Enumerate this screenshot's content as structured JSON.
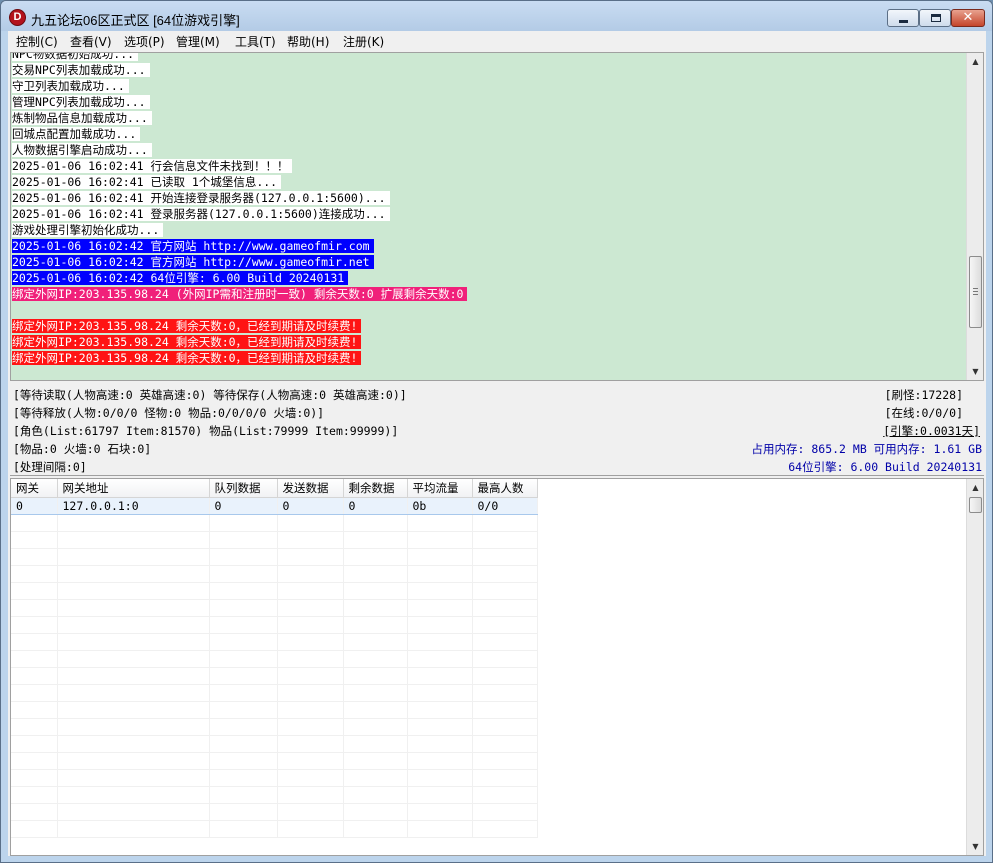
{
  "window": {
    "title": "九五论坛06区正式区 [64位游戏引擎]",
    "icon_letter": "D",
    "minimize": "minimize",
    "maximize": "maximize",
    "close": "✕"
  },
  "menu": [
    "控制(C)",
    "查看(V)",
    "选项(P)",
    "管理(M)",
    "工具(T)",
    "帮助(H)",
    "注册(K)"
  ],
  "log": [
    {
      "text": "NPC物数据初始成功...",
      "style": "white"
    },
    {
      "text": "交易NPC列表加载成功...",
      "style": "white"
    },
    {
      "text": "守卫列表加载成功...",
      "style": "white"
    },
    {
      "text": "管理NPC列表加载成功...",
      "style": "white"
    },
    {
      "text": "炼制物品信息加载成功...",
      "style": "white"
    },
    {
      "text": "回城点配置加载成功...",
      "style": "white"
    },
    {
      "text": "人物数据引擎启动成功...",
      "style": "white"
    },
    {
      "text": "2025-01-06 16:02:41 行会信息文件未找到！！！",
      "style": "white"
    },
    {
      "text": "2025-01-06 16:02:41 已读取 1个城堡信息...",
      "style": "white"
    },
    {
      "text": "2025-01-06 16:02:41 开始连接登录服务器(127.0.0.1:5600)...",
      "style": "white"
    },
    {
      "text": "2025-01-06 16:02:41 登录服务器(127.0.0.1:5600)连接成功...",
      "style": "white"
    },
    {
      "text": "游戏处理引擎初始化成功...",
      "style": "white"
    },
    {
      "text": "2025-01-06 16:02:42 官方网站 http://www.gameofmir.com",
      "style": "blue"
    },
    {
      "text": "2025-01-06 16:02:42 官方网站 http://www.gameofmir.net",
      "style": "blue"
    },
    {
      "text": "2025-01-06 16:02:42 64位引擎: 6.00 Build 20240131",
      "style": "blue"
    },
    {
      "text": "绑定外网IP:203.135.98.24 (外网IP需和注册时一致) 剩余天数:0 扩展剩余天数:0",
      "style": "pink"
    },
    {
      "text": "",
      "style": "empty"
    },
    {
      "text": "绑定外网IP:203.135.98.24 剩余天数:0，已经到期请及时续费!",
      "style": "red"
    },
    {
      "text": "绑定外网IP:203.135.98.24 剩余天数:0，已经到期请及时续费!",
      "style": "red"
    },
    {
      "text": "绑定外网IP:203.135.98.24 剩余天数:0，已经到期请及时续费!",
      "style": "red"
    }
  ],
  "status": {
    "line1": "[等待读取(人物高速:0 英雄高速:0) 等待保存(人物高速:0 英雄高速:0)]",
    "line2": "[等待释放(人物:0/0/0 怪物:0 物品:0/0/0/0 火墙:0)]",
    "line3": "[角色(List:61797 Item:81570) 物品(List:79999 Item:99999)]",
    "line4": "[物品:0 火墙:0 石块:0]",
    "line5": "[处理间隔:0]",
    "monsters": "[刷怪:17228]",
    "online": "[在线:0/0/0]",
    "engine": "[引擎:0.0031天]",
    "memory": "占用内存: 865.2 MB 可用内存: 1.61 GB",
    "version": "64位引擎: 6.00 Build 20240131"
  },
  "gateway_table": {
    "columns": [
      "网关",
      "网关地址",
      "队列数据",
      "发送数据",
      "剩余数据",
      "平均流量",
      "最高人数"
    ],
    "rows": [
      [
        "0",
        "127.0.0.1:0",
        "0",
        "0",
        "0",
        "0b",
        "0/0"
      ]
    ]
  }
}
